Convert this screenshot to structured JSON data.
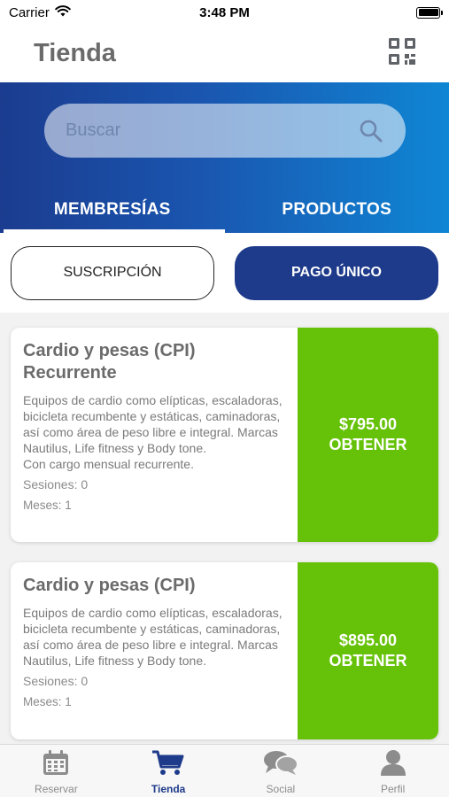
{
  "status_bar": {
    "carrier": "Carrier",
    "time": "3:48 PM"
  },
  "header": {
    "title": "Tienda",
    "qr_icon": "qr-code-icon"
  },
  "search": {
    "placeholder": "Buscar",
    "icon": "search-icon"
  },
  "tabs": [
    {
      "label": "MEMBRESÍAS",
      "active": true
    },
    {
      "label": "PRODUCTOS",
      "active": false
    }
  ],
  "payment_toggle": {
    "subscription_label": "SUSCRIPCIÓN",
    "single_label": "PAGO ÚNICO",
    "selected": "PAGO ÚNICO"
  },
  "cards": [
    {
      "title": "Cardio y pesas (CPI) Recurrente",
      "description": "Equipos de cardio como elípticas, escaladoras, bicicleta recumbente y estáticas, caminadoras, así como área de peso libre e integral. Marcas Nautilus, Life fitness y Body tone.",
      "note": "Con cargo mensual recurrente.",
      "sessions": "Sesiones:  0",
      "months": "Meses:  1",
      "price": "$795.00",
      "cta": "OBTENER"
    },
    {
      "title": "Cardio y pesas (CPI)",
      "description": "Equipos de cardio como elípticas, escaladoras, bicicleta recumbente y estáticas, caminadoras, así como área de peso libre e integral. Marcas Nautilus, Life fitness y Body tone.",
      "sessions": "Sesiones:  0",
      "months": "Meses:  1",
      "price": "$895.00",
      "cta": "OBTENER"
    }
  ],
  "tabbar": [
    {
      "label": "Reservar",
      "icon": "calendar-icon",
      "active": false
    },
    {
      "label": "Tienda",
      "icon": "cart-icon",
      "active": true
    },
    {
      "label": "Social",
      "icon": "chat-bubbles-icon",
      "active": false
    },
    {
      "label": "Perfil",
      "icon": "person-icon",
      "active": false
    }
  ],
  "colors": {
    "brand": "#1e3a8a",
    "cta": "#66c208",
    "hero_start": "#1b3c8f",
    "hero_end": "#0f86d4"
  }
}
